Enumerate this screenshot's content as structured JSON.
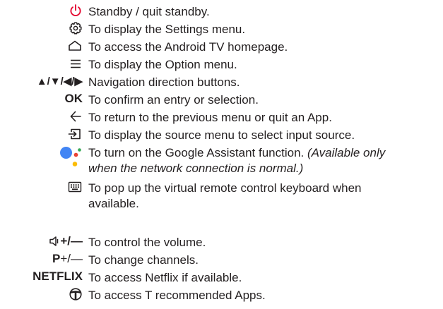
{
  "entries": [
    {
      "icon": "power-icon",
      "symbol": "",
      "text": "Standby / quit standby."
    },
    {
      "icon": "gear-icon",
      "symbol": "",
      "text": "To display the Settings menu."
    },
    {
      "icon": "home-icon",
      "symbol": "",
      "text": "To access the Android TV homepage."
    },
    {
      "icon": "menu-icon",
      "symbol": "",
      "text": "To display the Option menu."
    },
    {
      "icon": "",
      "symbol": "▲/▼/◀/▶",
      "text": "Navigation direction buttons."
    },
    {
      "icon": "",
      "symbol": "OK",
      "text": "To confirm an entry or selection."
    },
    {
      "icon": "back-arrow-icon",
      "symbol": "",
      "text": "To return to the previous menu or quit an App."
    },
    {
      "icon": "input-source-icon",
      "symbol": "",
      "text": "To display the source menu to select input source."
    },
    {
      "icon": "google-assistant-icon",
      "symbol": "",
      "text": "To turn on the Google Assistant function.",
      "note_line1": "(Available only",
      "note_line2": "when the network connection is normal.)"
    },
    {
      "icon": "keyboard-icon",
      "symbol": "",
      "text": "To pop up the virtual remote control keyboard when",
      "text_line2": "available."
    },
    {
      "icon": "volume-icon",
      "symbol": "+/—",
      "text": "To control the volume."
    },
    {
      "icon": "",
      "symbol_prefix": "P",
      "symbol": "+/—",
      "text": "To change channels."
    },
    {
      "icon": "",
      "symbol": "NETFLIX",
      "text": "To access Netflix if available."
    },
    {
      "icon": "t-apps-icon",
      "symbol": "",
      "text": "To access T recommended Apps."
    }
  ],
  "colors": {
    "text": "#231f20",
    "power_icon": "#e4002b",
    "assistant_blue": "#4285f4",
    "assistant_red": "#ea4335",
    "assistant_yellow": "#fbbc05",
    "assistant_green": "#34a853"
  }
}
